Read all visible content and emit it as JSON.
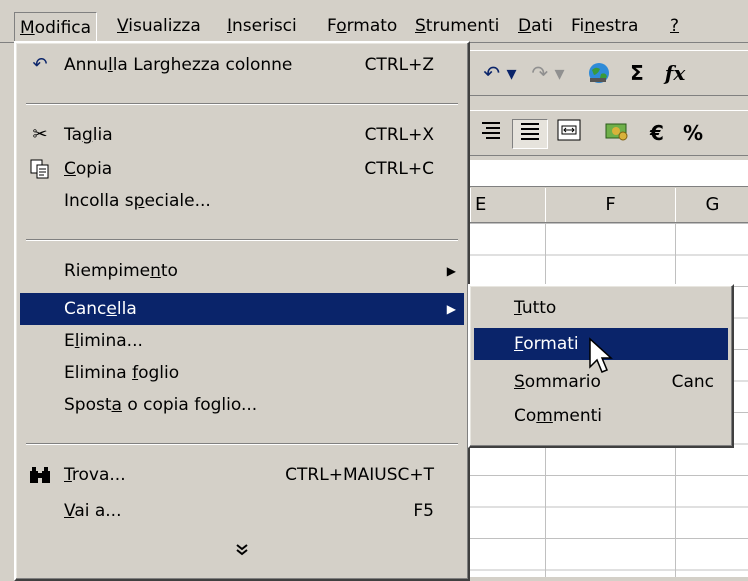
{
  "menubar": {
    "items": [
      {
        "pre": "",
        "u": "M",
        "post": "odifica"
      },
      {
        "pre": "",
        "u": "V",
        "post": "isualizza"
      },
      {
        "pre": "",
        "u": "I",
        "post": "nserisci"
      },
      {
        "pre": "F",
        "u": "o",
        "post": "rmato"
      },
      {
        "pre": "",
        "u": "S",
        "post": "trumenti"
      },
      {
        "pre": "",
        "u": "D",
        "post": "ati"
      },
      {
        "pre": "Fi",
        "u": "n",
        "post": "estra"
      },
      {
        "pre": "",
        "u": "?",
        "post": ""
      }
    ]
  },
  "main_menu": {
    "undo": {
      "pre": "Annu",
      "u": "l",
      "post": "la Larghezza colonne",
      "shortcut": "CTRL+Z"
    },
    "cut": {
      "pre": "Ta",
      "u": "g",
      "post": "lia",
      "shortcut": "CTRL+X"
    },
    "copy": {
      "pre": "",
      "u": "C",
      "post": "opia",
      "shortcut": "CTRL+C"
    },
    "paste_special": {
      "pre": "Incolla s",
      "u": "p",
      "post": "eciale..."
    },
    "fill": {
      "pre": "Riempime",
      "u": "n",
      "post": "to"
    },
    "clear": {
      "pre": "Canc",
      "u": "e",
      "post": "lla"
    },
    "delete": {
      "pre": "E",
      "u": "l",
      "post": "imina..."
    },
    "delete_sheet": {
      "pre": "Elimina ",
      "u": "f",
      "post": "oglio"
    },
    "move_sheet": {
      "pre": "Spost",
      "u": "a",
      "post": " o copia foglio..."
    },
    "find": {
      "pre": "",
      "u": "T",
      "post": "rova...",
      "shortcut": "CTRL+MAIUSC+T"
    },
    "goto": {
      "pre": "",
      "u": "V",
      "post": "ai a...",
      "shortcut": "F5"
    }
  },
  "sub_menu": {
    "all": {
      "pre": "",
      "u": "T",
      "post": "utto"
    },
    "formats": {
      "pre": "",
      "u": "F",
      "post": "ormati"
    },
    "contents": {
      "pre": "",
      "u": "S",
      "post": "ommario",
      "shortcut": "Canc"
    },
    "comments": {
      "pre": "Co",
      "u": "m",
      "post": "menti"
    }
  },
  "toolbar": {
    "undo_glyph": "↶ ▾",
    "redo_glyph": "↷ ▾",
    "sum_glyph": "Σ",
    "fx_glyph": "fx",
    "euro_glyph": "€",
    "percent_glyph": "%"
  },
  "columns": [
    "E",
    "F",
    "G"
  ],
  "colors": {
    "highlight": "#0a246a",
    "face": "#d4d0c8"
  }
}
